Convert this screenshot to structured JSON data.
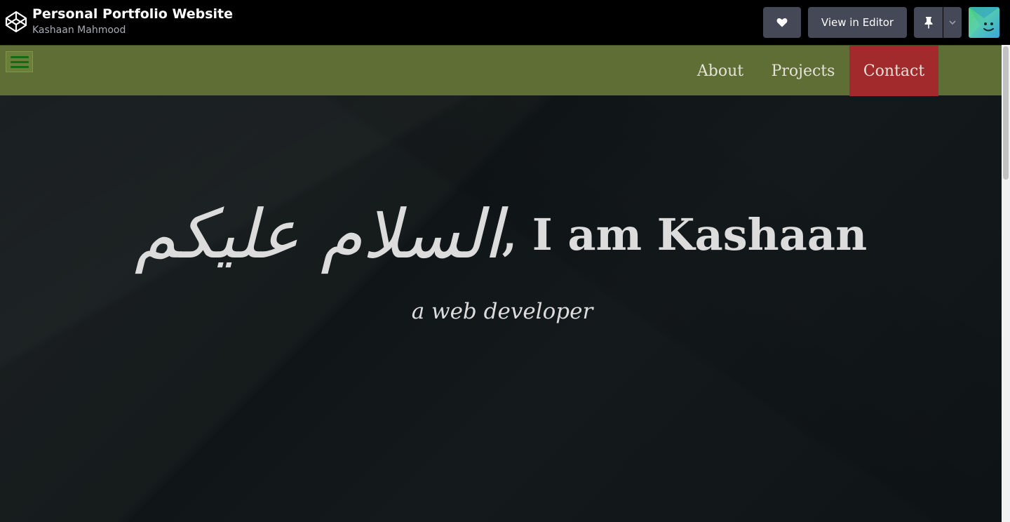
{
  "codepen": {
    "title": "Personal Portfolio Website",
    "author": "Kashaan Mahmood",
    "heart_icon": "heart-icon",
    "view_in_editor": "View in Editor",
    "pin_icon": "pin-icon",
    "pin_dropdown_icon": "chevron-down-icon",
    "logo_icon": "codepen-logo-icon",
    "avatar_icon": "smiley-avatar"
  },
  "site": {
    "menu_icon": "hamburger-icon",
    "nav": {
      "about": "About",
      "projects": "Projects",
      "contact": "Contact"
    },
    "colors": {
      "nav_bg": "#5e6e35",
      "contact_bg": "#a2292c",
      "hero_bg": "#161c1e",
      "text": "#dcdcdc"
    },
    "hero": {
      "arabic": "السلام عليكم",
      "greeting_rest": ", I am Kashaan",
      "subtitle": "a web developer"
    }
  }
}
